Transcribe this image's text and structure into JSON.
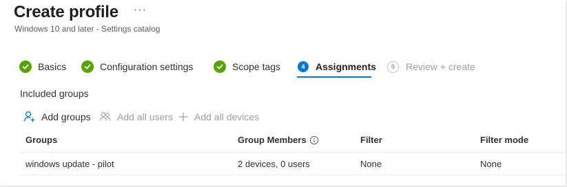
{
  "header": {
    "title": "Create profile",
    "more_label": "···",
    "subtitle": "Windows 10 and later - Settings catalog"
  },
  "wizard": {
    "steps": [
      {
        "label": "Basics",
        "state": "completed"
      },
      {
        "label": "Configuration settings",
        "state": "completed"
      },
      {
        "label": "Scope tags",
        "state": "completed"
      },
      {
        "label": "Assignments",
        "state": "active",
        "number": "4"
      },
      {
        "label": "Review + create",
        "state": "disabled",
        "number": "5"
      }
    ]
  },
  "assignments": {
    "section_title": "Included groups",
    "commands": {
      "add_groups": "Add groups",
      "add_all_users": "Add all users",
      "add_all_devices": "Add all devices"
    },
    "table": {
      "columns": [
        "Groups",
        "Group Members",
        "Filter",
        "Filter mode"
      ],
      "rows": [
        {
          "group": "windows update - pilot",
          "members": "2 devices, 0 users",
          "filter": "None",
          "filter_mode": "None"
        }
      ]
    }
  },
  "colors": {
    "accent": "#0078d4",
    "success": "#57a300",
    "disabled_text": "#a19f9d",
    "primary_text": "#323130"
  },
  "icons": {
    "completed_step": "checkmark-circle-icon",
    "add_groups": "add-person-icon",
    "add_all_users": "people-icon",
    "add_all_devices": "plus-icon",
    "column_info": "info-icon"
  }
}
